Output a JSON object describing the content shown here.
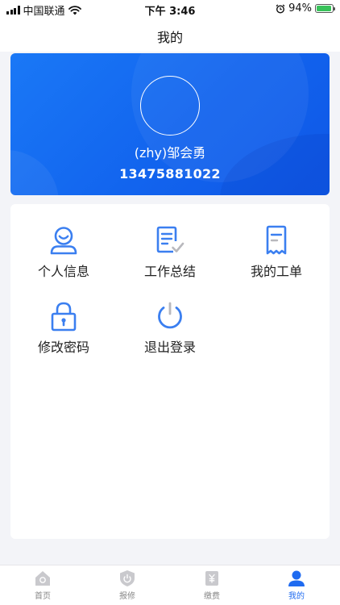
{
  "status_bar": {
    "carrier": "中国联通",
    "time": "下午 3:46",
    "battery_percent": "94%",
    "battery_level": 0.94
  },
  "nav": {
    "title": "我的"
  },
  "profile": {
    "name": "(zhy)邹会勇",
    "phone": "13475881022"
  },
  "menu": [
    {
      "label": "个人信息",
      "icon": "person-icon"
    },
    {
      "label": "工作总结",
      "icon": "document-check-icon"
    },
    {
      "label": "我的工单",
      "icon": "receipt-icon"
    },
    {
      "label": "修改密码",
      "icon": "lock-icon"
    },
    {
      "label": "退出登录",
      "icon": "power-icon"
    }
  ],
  "tabs": [
    {
      "label": "首页",
      "icon": "home-icon",
      "active": false
    },
    {
      "label": "报修",
      "icon": "shield-icon",
      "active": false
    },
    {
      "label": "缴费",
      "icon": "yuan-icon",
      "active": false
    },
    {
      "label": "我的",
      "icon": "user-icon",
      "active": true
    }
  ],
  "colors": {
    "accent": "#1f6bf0",
    "card_gradient_start": "#1a78f6",
    "card_gradient_end": "#0f57e6",
    "icon_blue": "#3b7ff0",
    "icon_gray": "#b8b8bd"
  }
}
